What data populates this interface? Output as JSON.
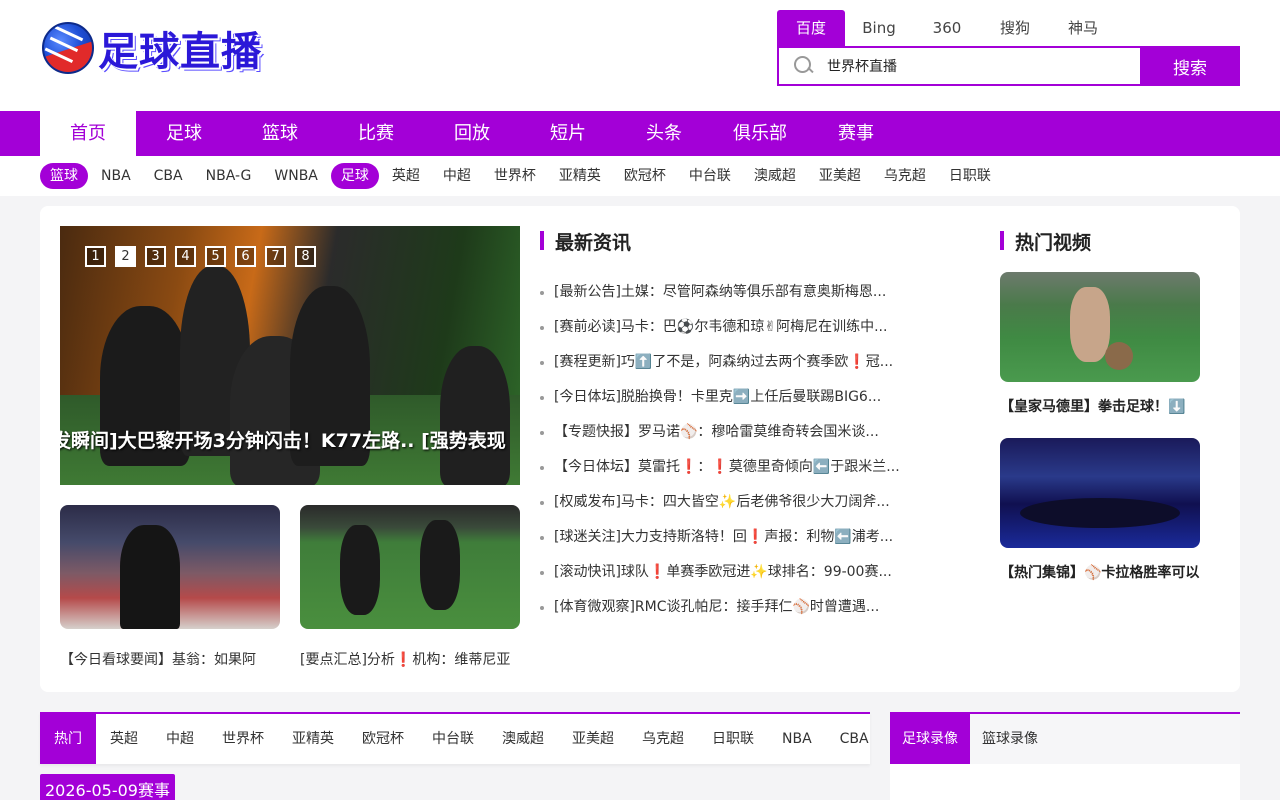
{
  "header": {
    "logo_text": "足球直播",
    "search_tabs": [
      "百度",
      "Bing",
      "360",
      "搜狗",
      "神马"
    ],
    "search_value": "世界杯直播",
    "search_button": "搜索"
  },
  "main_nav": [
    "首页",
    "足球",
    "篮球",
    "比赛",
    "回放",
    "短片",
    "头条",
    "俱乐部",
    "赛事"
  ],
  "sub_nav": [
    "篮球",
    "NBA",
    "CBA",
    "NBA-G",
    "WNBA",
    "足球",
    "英超",
    "中超",
    "世界杯",
    "亚精英",
    "欧冠杯",
    "中台联",
    "澳威超",
    "亚美超",
    "乌克超",
    "日职联"
  ],
  "slider": {
    "caption": "发瞬间]大巴黎开场3分钟闪击！K77左路..   [强势表现",
    "dots": [
      "1",
      "2",
      "3",
      "4",
      "5",
      "6",
      "7",
      "8"
    ],
    "active_dot": 1
  },
  "thumbs": [
    {
      "caption": "【今日看球要闻】基翁：如果阿"
    },
    {
      "caption": "[要点汇总]分析❗机构：维蒂尼亚"
    }
  ],
  "news": {
    "title": "最新资讯",
    "items": [
      "[最新公告]土媒：尽管阿森纳等俱乐部有意奥斯梅恩...",
      "[赛前必读]马卡：巴⚽尔韦德和琼✌阿梅尼在训练中...",
      "[赛程更新]巧⬆️了不是，阿森纳过去两个赛季欧❗冠...",
      "[今日体坛]脱胎换骨！卡里克➡️上任后曼联踢BIG6...",
      "【专题快报】罗马诺⚾：穆哈雷莫维奇转会国米谈...",
      "【今日体坛】莫雷托❗：❗莫德里奇倾向⬅️于跟米兰...",
      "[权威发布]马卡：四大皆空✨后老佛爷很少大刀阔斧...",
      "[球迷关注]大力支持斯洛特！回❗声报：利物⬅️浦考...",
      "[滚动快讯]球队❗单赛季欧冠进✨球排名：99-00赛...",
      "[体育微观察]RMC谈孔帕尼：接手拜仁⚾时曾遭遇..."
    ]
  },
  "videos": {
    "title": "热门视频",
    "items": [
      {
        "caption": "【皇家马德里】拳击足球！⬇️"
      },
      {
        "caption": "【热门集锦】⚾卡拉格胜率可以"
      }
    ]
  },
  "bottom": {
    "tabs": [
      "热门",
      "英超",
      "中超",
      "世界杯",
      "亚精英",
      "欧冠杯",
      "中台联",
      "澳威超",
      "亚美超",
      "乌克超",
      "日职联",
      "NBA",
      "CBA"
    ],
    "date": "2026-05-09赛事",
    "right_tabs": [
      "足球录像",
      "篮球录像"
    ]
  },
  "colors": {
    "accent": "#a300d7"
  }
}
